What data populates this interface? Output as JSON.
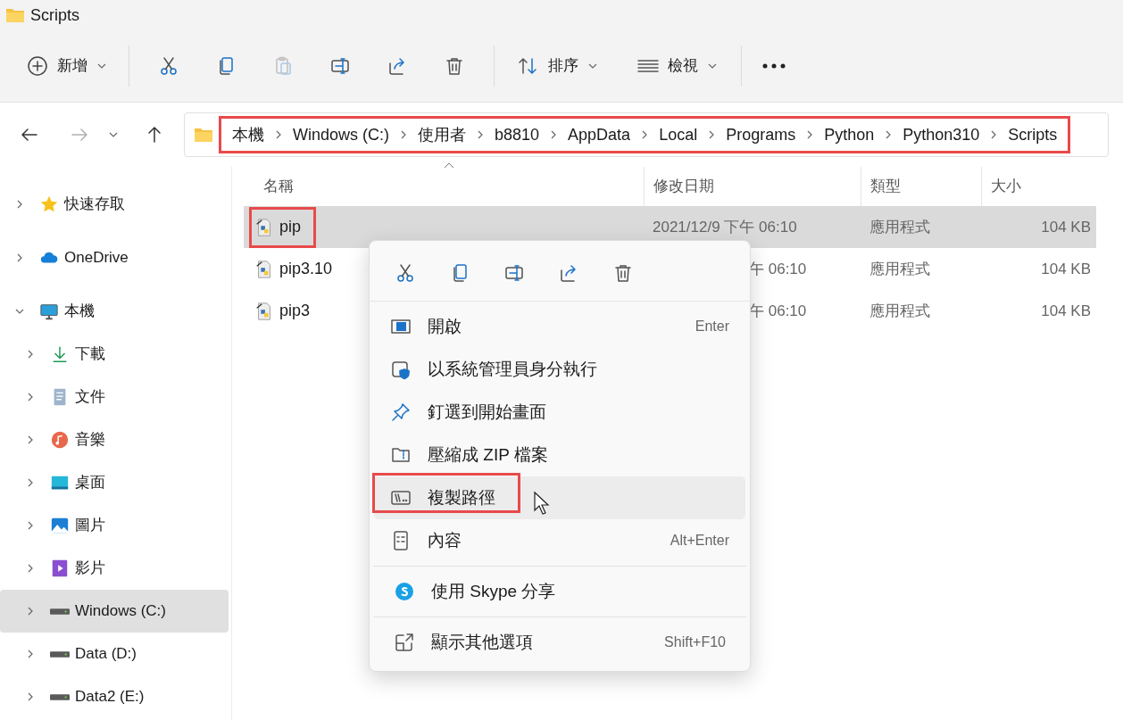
{
  "window": {
    "title": "Scripts"
  },
  "toolbar": {
    "new": {
      "label": "新增"
    },
    "actions": [
      {
        "kind": "cut",
        "disabled": false
      },
      {
        "kind": "copy",
        "disabled": false
      },
      {
        "kind": "paste",
        "disabled": true
      },
      {
        "kind": "rename",
        "disabled": false
      },
      {
        "kind": "share",
        "disabled": false
      },
      {
        "kind": "delete",
        "disabled": false
      }
    ],
    "sort": {
      "label": "排序"
    },
    "view": {
      "label": "檢視"
    }
  },
  "nav": {
    "forward_disabled": true
  },
  "breadcrumb": {
    "highlighted": true,
    "items": [
      "本機",
      "Windows (C:)",
      "使用者",
      "b8810",
      "AppData",
      "Local",
      "Programs",
      "Python",
      "Python310",
      "Scripts"
    ]
  },
  "sidebar": {
    "items": [
      {
        "label": "快速存取",
        "kind": "star",
        "expanded": false,
        "selected": false
      },
      {
        "label": "OneDrive",
        "kind": "cloud",
        "expanded": false,
        "selected": false
      },
      {
        "label": "本機",
        "kind": "pc",
        "expanded": true,
        "selected": false,
        "children": [
          {
            "label": "下載",
            "kind": "download",
            "expanded": false,
            "selected": false
          },
          {
            "label": "文件",
            "kind": "document",
            "expanded": false,
            "selected": false
          },
          {
            "label": "音樂",
            "kind": "music",
            "expanded": false,
            "selected": false
          },
          {
            "label": "桌面",
            "kind": "desktop",
            "expanded": false,
            "selected": false
          },
          {
            "label": "圖片",
            "kind": "pictures",
            "expanded": false,
            "selected": false
          },
          {
            "label": "影片",
            "kind": "videos",
            "expanded": false,
            "selected": false
          },
          {
            "label": "Windows (C:)",
            "kind": "drive",
            "expanded": false,
            "selected": true
          },
          {
            "label": "Data (D:)",
            "kind": "drive",
            "expanded": false,
            "selected": false
          },
          {
            "label": "Data2 (E:)",
            "kind": "drive",
            "expanded": false,
            "selected": false
          }
        ]
      }
    ]
  },
  "table": {
    "columns": [
      {
        "label": "名稱",
        "sorted": true
      },
      {
        "label": "修改日期",
        "sorted": false
      },
      {
        "label": "類型",
        "sorted": false
      },
      {
        "label": "大小",
        "sorted": false
      }
    ],
    "rows": [
      {
        "name": "pip",
        "date": "2021/12/9 下午 06:10",
        "type": "應用程式",
        "size": "104 KB",
        "selected": true,
        "highlighted": true
      },
      {
        "name": "pip3.10",
        "date": "午 06:10",
        "type": "應用程式",
        "size": "104 KB",
        "selected": false,
        "highlighted": false
      },
      {
        "name": "pip3",
        "date": "午 06:10",
        "type": "應用程式",
        "size": "104 KB",
        "selected": false,
        "highlighted": false
      }
    ]
  },
  "context_menu": {
    "actions": [
      {
        "kind": "cut"
      },
      {
        "kind": "copy"
      },
      {
        "kind": "rename"
      },
      {
        "kind": "share"
      },
      {
        "kind": "delete"
      }
    ],
    "groups": [
      [
        {
          "label": "開啟",
          "kind": "open",
          "shortcut": "Enter",
          "selected": false,
          "highlighted": false
        },
        {
          "label": "以系統管理員身分執行",
          "kind": "admin",
          "selected": false,
          "highlighted": false
        },
        {
          "label": "釘選到開始畫面",
          "kind": "pin",
          "selected": false,
          "highlighted": false
        },
        {
          "label": "壓縮成 ZIP 檔案",
          "kind": "zip",
          "selected": false,
          "highlighted": false
        },
        {
          "label": "複製路徑",
          "kind": "path",
          "selected": true,
          "highlighted": true
        },
        {
          "label": "內容",
          "kind": "properties",
          "shortcut": "Alt+Enter",
          "selected": false,
          "highlighted": false
        }
      ],
      [
        {
          "label": "使用 Skype 分享",
          "kind": "skype",
          "selected": false,
          "highlighted": false
        }
      ],
      [
        {
          "label": "顯示其他選項",
          "kind": "more",
          "shortcut": "Shift+F10",
          "selected": false,
          "highlighted": false
        }
      ]
    ]
  }
}
